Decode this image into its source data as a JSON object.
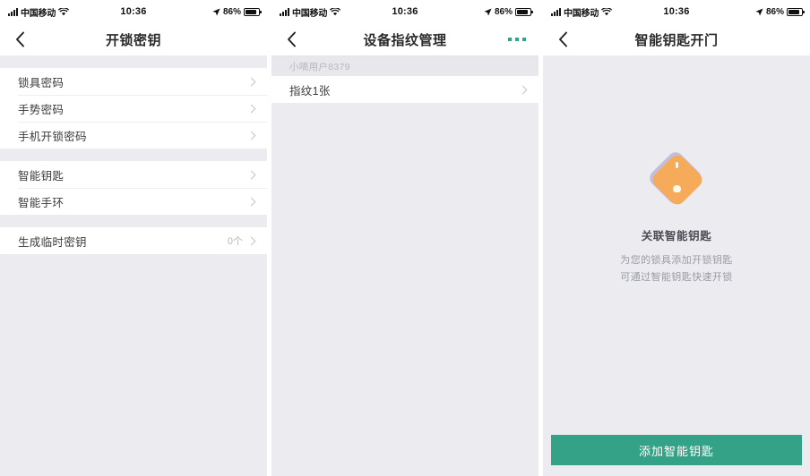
{
  "statusbar": {
    "carrier": "中国移动",
    "time": "10:36",
    "battery_pct": "86%",
    "signal_icon": "signal-bars-icon",
    "wifi_icon": "wifi-icon",
    "location_icon": "location-arrow-icon",
    "battery_icon": "battery-icon"
  },
  "screens": [
    {
      "nav": {
        "back_icon": "back-chevron-icon",
        "title": "开锁密钥"
      },
      "groups": [
        {
          "rows": [
            {
              "label": "锁具密码",
              "value": ""
            },
            {
              "label": "手势密码",
              "value": ""
            },
            {
              "label": "手机开锁密码",
              "value": ""
            }
          ]
        },
        {
          "rows": [
            {
              "label": "智能钥匙",
              "value": ""
            },
            {
              "label": "智能手环",
              "value": ""
            }
          ]
        },
        {
          "rows": [
            {
              "label": "生成临时密钥",
              "value": "0个"
            }
          ]
        }
      ]
    },
    {
      "nav": {
        "back_icon": "back-chevron-icon",
        "title": "设备指纹管理",
        "more_icon": "more-dots-icon"
      },
      "section_header": "小嘀用户8379",
      "groups": [
        {
          "rows": [
            {
              "label": "指纹1张",
              "value": ""
            }
          ]
        }
      ]
    },
    {
      "nav": {
        "back_icon": "back-chevron-icon",
        "title": "智能钥匙开门"
      },
      "empty_state": {
        "icon": "smart-key-diamond-icon",
        "title": "关联智能钥匙",
        "line1": "为您的锁具添加开锁钥匙",
        "line2": "可通过智能钥匙快速开锁"
      },
      "primary_button": "添加智能钥匙"
    }
  ],
  "colors": {
    "accent_green": "#34a287",
    "more_dots_green": "#2fa588",
    "icon_orange": "#f6ab5a",
    "icon_purple": "#bdb6d8",
    "panel_bg": "#ececf0"
  }
}
